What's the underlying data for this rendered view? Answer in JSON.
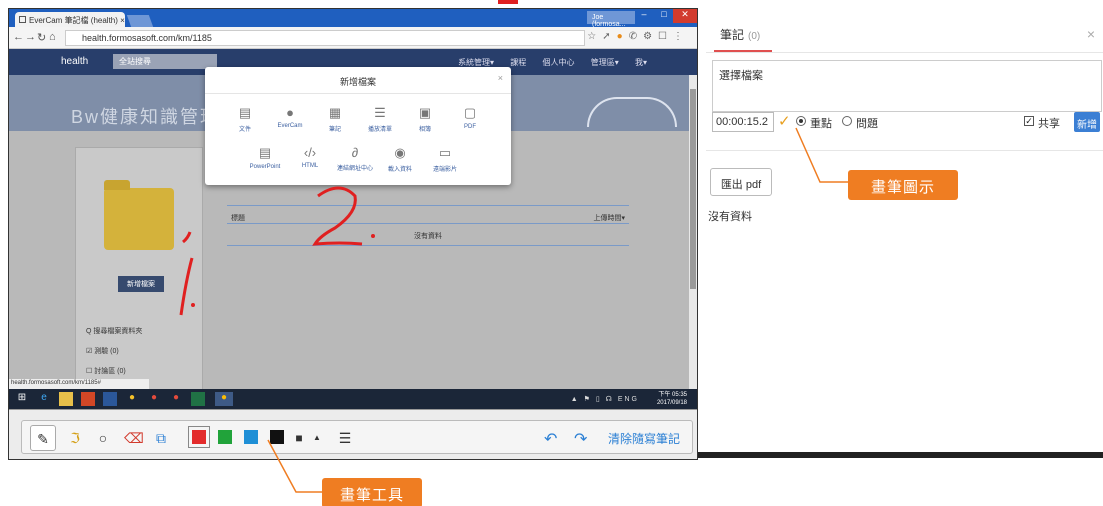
{
  "browser": {
    "tab_title": "EverCam 筆記檔 (health) ×",
    "user": "Joe (formosa...",
    "url": "health.formosasoft.com/km/1185",
    "status_url": "health.formosasoft.com/km/1185#"
  },
  "site": {
    "brand": "health",
    "search_placeholder": "全站搜尋",
    "menu": "系統管理▾ 課程 個人中心 管理區▾ 我▾",
    "banner_text": "Bw健康知識管理系",
    "new_folder_label": "新增檔案",
    "links": [
      "Q 搜尋檔案資料夾",
      "☑ 測驗 (0)",
      "☐ 討論區 (0)"
    ],
    "table_header": "標題",
    "table_header_right": "上傳時間▾",
    "table_empty": "沒有資料"
  },
  "modal": {
    "title": "新增檔案",
    "items_row1": [
      {
        "label": "文件",
        "icon": "document-icon"
      },
      {
        "label": "EverCam",
        "icon": "evercam-icon"
      },
      {
        "label": "筆記",
        "icon": "note-icon"
      },
      {
        "label": "播放清單",
        "icon": "playlist-icon"
      },
      {
        "label": "相簿",
        "icon": "album-icon"
      },
      {
        "label": "PDF",
        "icon": "pdf-icon"
      }
    ],
    "items_row2": [
      {
        "label": "PowerPoint",
        "icon": "powerpoint-icon"
      },
      {
        "label": "HTML",
        "icon": "html-icon"
      },
      {
        "label": "連結網址中心",
        "icon": "link-icon"
      },
      {
        "label": "載入資料",
        "icon": "import-icon"
      },
      {
        "label": "遠端影片",
        "icon": "video-icon"
      }
    ]
  },
  "taskbar": {
    "clock_time": "下午 05:35",
    "clock_date": "2017/09/18",
    "tray": "▲ ⚑ ▯ ☊ ENG"
  },
  "pen_toolbar": {
    "clear_label": "清除隨寫筆記",
    "colors": [
      "#e32b2b",
      "#21a33a",
      "#1f8fd6",
      "#111111"
    ]
  },
  "panel": {
    "tab_label": "筆記",
    "tab_count": "(0)",
    "note_text": "選擇檔案",
    "time_value": "00:00:15.2",
    "radio_key": "重點",
    "radio_question": "問題",
    "share_label": "共享",
    "add_label": "新增",
    "export_pdf_label": "匯出 pdf",
    "no_data": "沒有資料"
  },
  "annotations": {
    "callout_pen_icon": "畫筆圖示",
    "callout_pen_tools": "畫筆工具",
    "ink_number_1": "1.",
    "ink_number_2": "2."
  },
  "colors": {
    "accent_orange": "#ef7d22",
    "ink_red": "#e02020",
    "nav_blue": "#283e6b",
    "button_blue": "#3b7fd4"
  }
}
